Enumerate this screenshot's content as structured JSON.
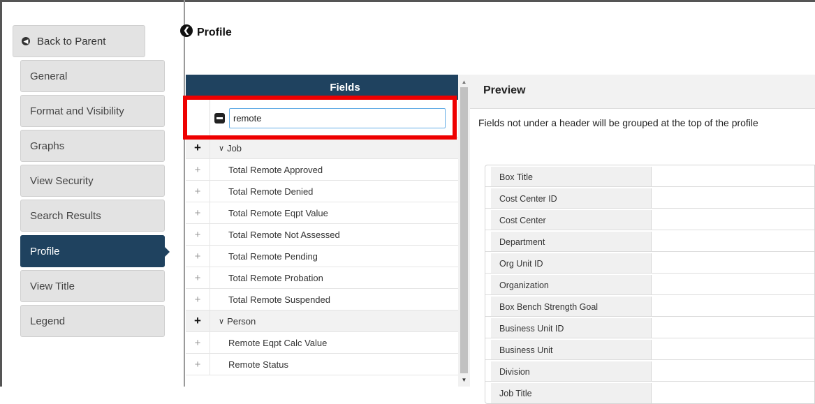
{
  "nav": {
    "back_label": "Back to Parent",
    "items": [
      {
        "label": "General"
      },
      {
        "label": "Format and Visibility"
      },
      {
        "label": "Graphs"
      },
      {
        "label": "View Security"
      },
      {
        "label": "Search Results"
      },
      {
        "label": "Profile",
        "active": true
      },
      {
        "label": "View Title"
      },
      {
        "label": "Legend"
      }
    ]
  },
  "header": {
    "title": "Profile"
  },
  "fields": {
    "header": "Fields",
    "search_value": "remote",
    "rows": [
      {
        "type": "group",
        "label": "Job"
      },
      {
        "type": "field",
        "label": "Total Remote Approved"
      },
      {
        "type": "field",
        "label": "Total Remote Denied"
      },
      {
        "type": "field",
        "label": "Total Remote Eqpt Value"
      },
      {
        "type": "field",
        "label": "Total Remote Not Assessed"
      },
      {
        "type": "field",
        "label": "Total Remote Pending"
      },
      {
        "type": "field",
        "label": "Total Remote Probation"
      },
      {
        "type": "field",
        "label": "Total Remote Suspended"
      },
      {
        "type": "group",
        "label": "Person"
      },
      {
        "type": "field",
        "label": "Remote Eqpt Calc Value"
      },
      {
        "type": "field",
        "label": "Remote Status"
      }
    ]
  },
  "preview": {
    "title": "Preview",
    "note": "Fields not under a header will be grouped at the top of the profile",
    "rows": [
      "Box Title",
      "Cost Center ID",
      "Cost Center",
      "Department",
      "Org Unit ID",
      "Organization",
      "Box Bench Strength Goal",
      "Business Unit ID",
      "Business Unit",
      "Division",
      "Job Title"
    ]
  },
  "colors": {
    "accent": "#1f425f",
    "highlight": "#ee0000"
  }
}
